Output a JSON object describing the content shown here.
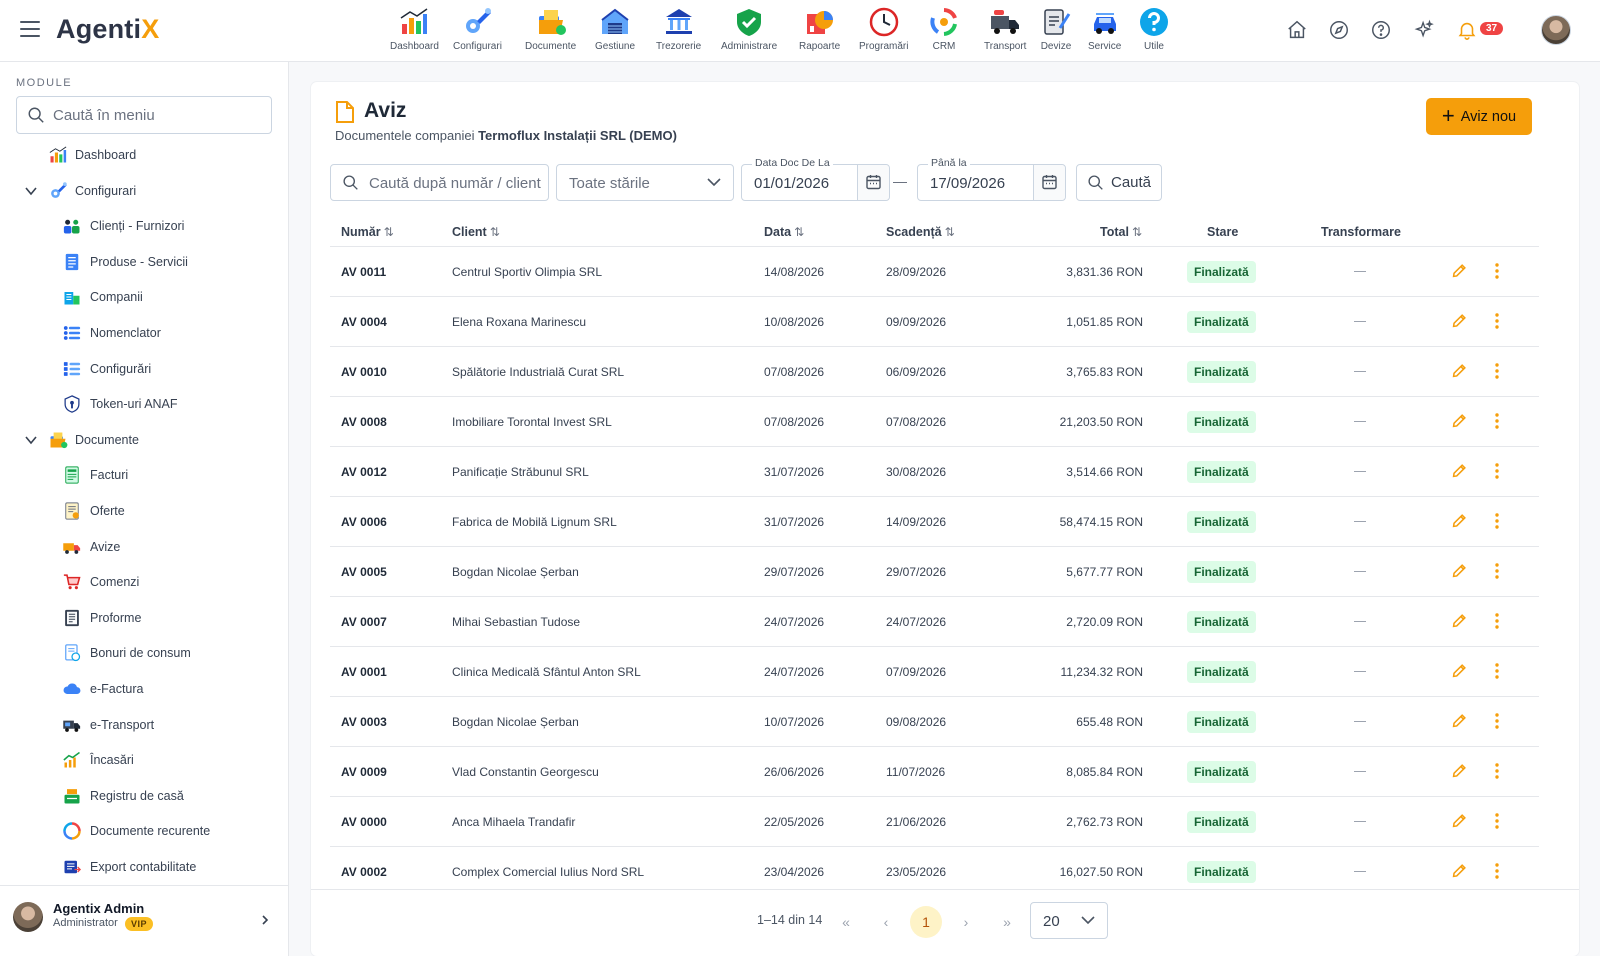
{
  "app": {
    "logo_main": "Agenti",
    "logo_accent": "X"
  },
  "modules": [
    {
      "label": "Dashboard",
      "icon": "dashboard-chart-icon"
    },
    {
      "label": "Configurari",
      "icon": "wrench-gear-icon"
    },
    {
      "label": "Documente",
      "icon": "documents-folder-icon"
    },
    {
      "label": "Gestiune",
      "icon": "warehouse-icon"
    },
    {
      "label": "Trezorerie",
      "icon": "bank-icon"
    },
    {
      "label": "Administrare",
      "icon": "shield-check-icon"
    },
    {
      "label": "Rapoarte",
      "icon": "reports-pie-icon"
    },
    {
      "label": "Programări",
      "icon": "clock-icon"
    },
    {
      "label": "CRM",
      "icon": "crm-cycle-icon"
    },
    {
      "label": "Transport",
      "icon": "truck-icon"
    },
    {
      "label": "Devize",
      "icon": "estimate-clipboard-icon"
    },
    {
      "label": "Service",
      "icon": "car-service-icon"
    },
    {
      "label": "Utile",
      "icon": "help-circle-icon"
    }
  ],
  "notifications": {
    "count": "37"
  },
  "sidebar": {
    "section_title": "MODULE",
    "search_placeholder": "Caută în meniu",
    "items": [
      {
        "label": "Dashboard",
        "level": 0
      },
      {
        "label": "Configurari",
        "level": 0,
        "expanded": true
      },
      {
        "label": "Clienți - Furnizori",
        "level": 1
      },
      {
        "label": "Produse - Servicii",
        "level": 1
      },
      {
        "label": "Companii",
        "level": 1
      },
      {
        "label": "Nomenclator",
        "level": 1
      },
      {
        "label": "Configurări",
        "level": 1
      },
      {
        "label": "Token-uri ANAF",
        "level": 1
      },
      {
        "label": "Documente",
        "level": 0,
        "expanded": true
      },
      {
        "label": "Facturi",
        "level": 1
      },
      {
        "label": "Oferte",
        "level": 1
      },
      {
        "label": "Avize",
        "level": 1
      },
      {
        "label": "Comenzi",
        "level": 1
      },
      {
        "label": "Proforme",
        "level": 1
      },
      {
        "label": "Bonuri de consum",
        "level": 1
      },
      {
        "label": "e-Factura",
        "level": 1
      },
      {
        "label": "e-Transport",
        "level": 1
      },
      {
        "label": "Încasări",
        "level": 1
      },
      {
        "label": "Registru de casă",
        "level": 1
      },
      {
        "label": "Documente recurente",
        "level": 1
      },
      {
        "label": "Export contabilitate",
        "level": 1
      }
    ],
    "user": {
      "name": "Agentix Admin",
      "role": "Administrator",
      "badge": "VIP"
    }
  },
  "page": {
    "title": "Aviz",
    "subtitle_prefix": "Documentele companiei ",
    "company": "Termoflux Instalații SRL (DEMO)",
    "new_button": "Aviz nou"
  },
  "filters": {
    "search_placeholder": "Caută după număr / client",
    "status_value": "Toate stările",
    "date_from_label": "Data Doc De La",
    "date_from": "01/01/2026",
    "date_to_label": "Până la",
    "date_to": "17/09/2026",
    "search_button": "Caută"
  },
  "table": {
    "columns": [
      "Număr",
      "Client",
      "Data",
      "Scadență",
      "Total",
      "Stare",
      "Transformare"
    ],
    "rows": [
      {
        "number": "AV 0011",
        "client": "Centrul Sportiv Olimpia SRL",
        "date": "14/08/2026",
        "due": "28/09/2026",
        "total": "3,831.36 RON",
        "status": "Finalizată",
        "transform": "—"
      },
      {
        "number": "AV 0004",
        "client": "Elena Roxana Marinescu",
        "date": "10/08/2026",
        "due": "09/09/2026",
        "total": "1,051.85 RON",
        "status": "Finalizată",
        "transform": "—"
      },
      {
        "number": "AV 0010",
        "client": "Spălătorie Industrială Curat SRL",
        "date": "07/08/2026",
        "due": "06/09/2026",
        "total": "3,765.83 RON",
        "status": "Finalizată",
        "transform": "—"
      },
      {
        "number": "AV 0008",
        "client": "Imobiliare Torontal Invest SRL",
        "date": "07/08/2026",
        "due": "07/08/2026",
        "total": "21,203.50 RON",
        "status": "Finalizată",
        "transform": "—"
      },
      {
        "number": "AV 0012",
        "client": "Panificație Străbunul SRL",
        "date": "31/07/2026",
        "due": "30/08/2026",
        "total": "3,514.66 RON",
        "status": "Finalizată",
        "transform": "—"
      },
      {
        "number": "AV 0006",
        "client": "Fabrica de Mobilă Lignum SRL",
        "date": "31/07/2026",
        "due": "14/09/2026",
        "total": "58,474.15 RON",
        "status": "Finalizată",
        "transform": "—"
      },
      {
        "number": "AV 0005",
        "client": "Bogdan Nicolae Șerban",
        "date": "29/07/2026",
        "due": "29/07/2026",
        "total": "5,677.77 RON",
        "status": "Finalizată",
        "transform": "—"
      },
      {
        "number": "AV 0007",
        "client": "Mihai Sebastian Tudose",
        "date": "24/07/2026",
        "due": "24/07/2026",
        "total": "2,720.09 RON",
        "status": "Finalizată",
        "transform": "—"
      },
      {
        "number": "AV 0001",
        "client": "Clinica Medicală Sfântul Anton SRL",
        "date": "24/07/2026",
        "due": "07/09/2026",
        "total": "11,234.32 RON",
        "status": "Finalizată",
        "transform": "—"
      },
      {
        "number": "AV 0003",
        "client": "Bogdan Nicolae Șerban",
        "date": "10/07/2026",
        "due": "09/08/2026",
        "total": "655.48 RON",
        "status": "Finalizată",
        "transform": "—"
      },
      {
        "number": "AV 0009",
        "client": "Vlad Constantin Georgescu",
        "date": "26/06/2026",
        "due": "11/07/2026",
        "total": "8,085.84 RON",
        "status": "Finalizată",
        "transform": "—"
      },
      {
        "number": "AV 0000",
        "client": "Anca Mihaela Trandafir",
        "date": "22/05/2026",
        "due": "21/06/2026",
        "total": "2,762.73 RON",
        "status": "Finalizată",
        "transform": "—"
      },
      {
        "number": "AV 0002",
        "client": "Complex Comercial Iulius Nord SRL",
        "date": "23/04/2026",
        "due": "23/05/2026",
        "total": "16,027.50 RON",
        "status": "Finalizată",
        "transform": "—"
      }
    ]
  },
  "pagination": {
    "info": "1–14 din 14",
    "current_page": "1",
    "page_size": "20"
  },
  "colors": {
    "accent": "#f59e0b",
    "status_bg": "#dcfce7",
    "status_text": "#166534",
    "badge": "#ef4444"
  }
}
